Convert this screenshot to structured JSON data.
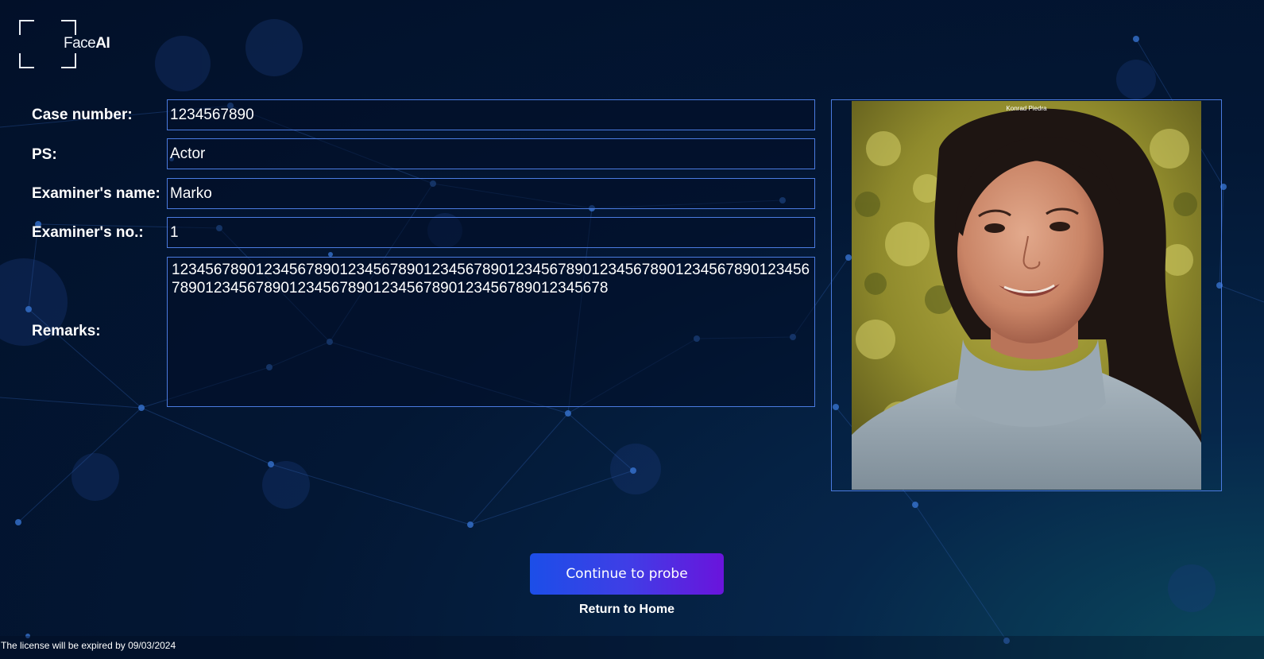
{
  "app": {
    "logo_text_light": "Face",
    "logo_text_bold": "AI"
  },
  "form": {
    "case_number": {
      "label": "Case number:",
      "value": "1234567890"
    },
    "ps": {
      "label": "PS:",
      "value": "Actor"
    },
    "examiner_name": {
      "label": "Examiner's name:",
      "value": "Marko"
    },
    "examiner_no": {
      "label": "Examiner's no.:",
      "value": "1"
    },
    "remarks": {
      "label": "Remarks:",
      "value": "12345678901234567890123456789012345678901234567890123456789012345678901234567890123456789012345678901234567890123456789012345678"
    }
  },
  "photo": {
    "caption": "Konrad Piedra"
  },
  "actions": {
    "continue_label": "Continue to probe",
    "home_label": "Return to Home"
  },
  "footer": {
    "license_text": "The license will be expired by 09/03/2024"
  },
  "colors": {
    "accent_border": "#4a7be0",
    "button_gradient_start": "#1c4ee8",
    "button_gradient_end": "#6a14dc",
    "background": "#031734"
  }
}
